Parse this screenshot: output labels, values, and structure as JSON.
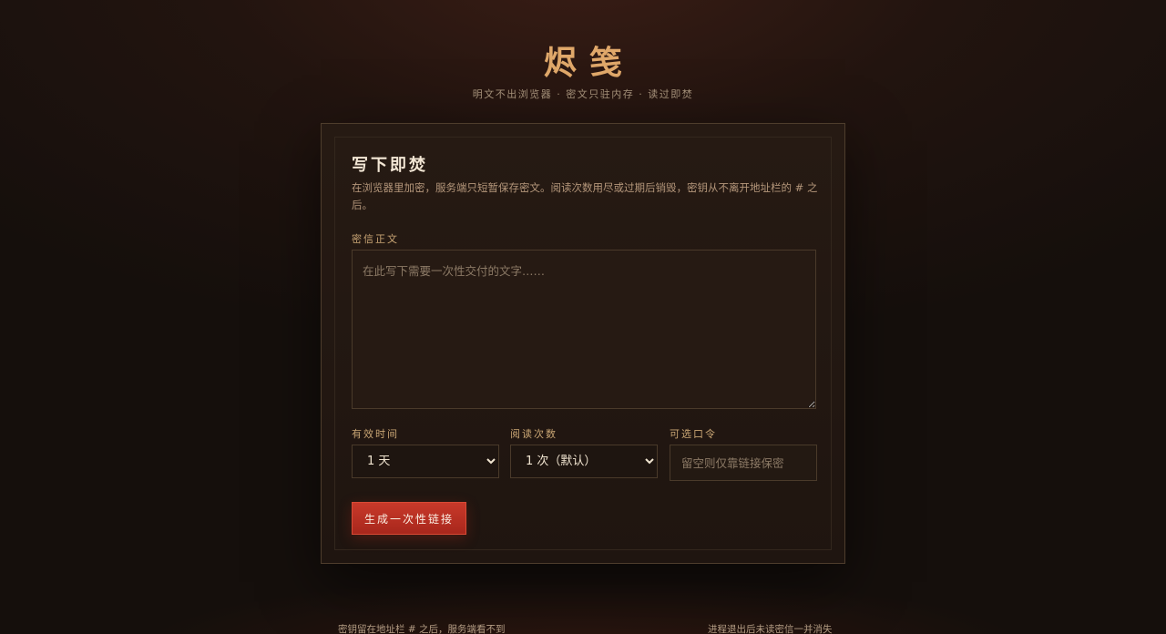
{
  "brand": {
    "title": "烬笺",
    "tagline": "明文不出浏览器 · 密文只驻内存 · 读过即焚"
  },
  "card": {
    "heading": "写下即焚",
    "description": "在浏览器里加密，服务端只短暂保存密文。阅读次数用尽或过期后销毁，密钥从不离开地址栏的 # 之后。",
    "message_label": "密信正文",
    "message_placeholder": "在此写下需要一次性交付的文字……",
    "message_value": "",
    "expiry_label": "有效时间",
    "expiry_selected": "1 天",
    "reads_label": "阅读次数",
    "reads_selected": "1 次（默认）",
    "passcode_label": "可选口令",
    "passcode_placeholder": "留空则仅靠链接保密",
    "submit_label": "生成一次性链接"
  },
  "footer": {
    "left_note": "密钥留在地址栏 # 之后，服务端看不到",
    "right_note": "进程退出后未读密信一并消失"
  },
  "colors": {
    "accent_gold": "#e0a86a",
    "button_red": "#c8392a",
    "background": "#1a120e"
  }
}
